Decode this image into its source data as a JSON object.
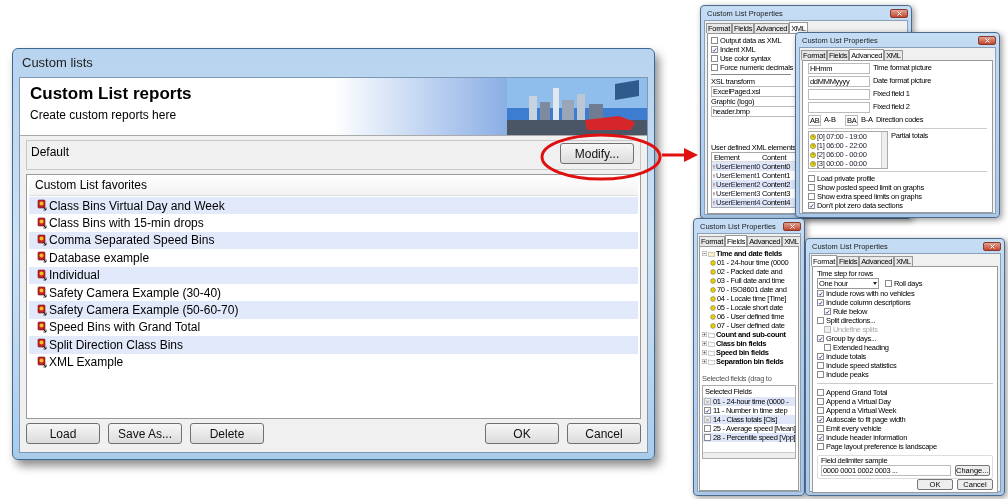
{
  "main_window": {
    "title": "Custom lists",
    "header": {
      "title": "Custom List reports",
      "subtitle": "Create custom reports here"
    },
    "profile": {
      "name": "Default",
      "button": "Modify..."
    },
    "list": {
      "header": "Custom List favorites",
      "items": [
        {
          "label": "Class Bins Virtual Day and Week"
        },
        {
          "label": "Class Bins with 15-min drops"
        },
        {
          "label": "Comma Separated Speed Bins"
        },
        {
          "label": "Database example"
        },
        {
          "label": "Individual"
        },
        {
          "label": "Safety Camera Example (30-40)"
        },
        {
          "label": "Safety Camera Example (50-60-70)"
        },
        {
          "label": "Speed Bins with Grand Total"
        },
        {
          "label": "Split Direction Class Bins"
        },
        {
          "label": "XML Example"
        }
      ]
    },
    "buttons_left": [
      "Load",
      "Save As...",
      "Delete"
    ],
    "buttons_right": [
      "OK",
      "Cancel"
    ]
  },
  "xml_dialog": {
    "title": "Custom List Properties",
    "tabs": [
      {
        "label": "Format",
        "selected": false
      },
      {
        "label": "Fields",
        "selected": false
      },
      {
        "label": "Advanced",
        "selected": false
      },
      {
        "label": "XML",
        "selected": true
      }
    ],
    "options": [
      {
        "label": "Output data as XML",
        "checked": false
      },
      {
        "label": "Indent XML",
        "checked": true
      },
      {
        "label": "Use color syntax",
        "checked": false
      },
      {
        "label": "Force numeric decimals",
        "checked": false
      }
    ],
    "xsl_label": "XSL transform",
    "xsl_value": "ExcelPaged.xsl",
    "graphic_label": "Graphic (logo)",
    "graphic_value": "header.bmp",
    "elements_label": "User defined XML elements",
    "columns": [
      "Element",
      "Content"
    ],
    "rows": [
      [
        "UserElement0",
        "Content0"
      ],
      [
        "UserElement1",
        "Content1"
      ],
      [
        "UserElement2",
        "Content2"
      ],
      [
        "UserElement3",
        "Content3"
      ],
      [
        "UserElement4",
        "Content4"
      ]
    ]
  },
  "advanced_dialog": {
    "title": "Custom List Properties",
    "tabs": [
      {
        "label": "Format",
        "selected": false
      },
      {
        "label": "Fields",
        "selected": false
      },
      {
        "label": "Advanced",
        "selected": true
      },
      {
        "label": "XML",
        "selected": false
      }
    ],
    "fields": [
      {
        "value": "HHmm",
        "label": "Time format picture"
      },
      {
        "value": "ddMMMyyyy",
        "label": "Date format picture"
      },
      {
        "label": "Fixed field 1"
      },
      {
        "label": "Fixed field 2"
      }
    ],
    "direction": {
      "ab_value": "AB",
      "ab_label": "A-B",
      "ba_value": "BA",
      "ba_label": "B-A",
      "label": "Direction codes"
    },
    "partial_totals": {
      "label": "Partial totals",
      "items": [
        "[0] 07:00 - 19:00",
        "[1] 06:00 - 22:00",
        "[2] 06:00 - 00:00",
        "[3] 00:00 - 00:00"
      ]
    },
    "options": [
      {
        "label": "Load private profile",
        "checked": false
      },
      {
        "label": "Show posted speed limit on graphs",
        "checked": false
      },
      {
        "label": "Show extra speed limits on graphs",
        "checked": false
      },
      {
        "label": "Don't plot zero data sections",
        "checked": true
      }
    ]
  },
  "fields_dialog": {
    "title": "Custom List Properties",
    "tabs": [
      {
        "label": "Format",
        "selected": false
      },
      {
        "label": "Fields",
        "selected": true
      },
      {
        "label": "Advanced",
        "selected": false
      },
      {
        "label": "XML",
        "selected": false
      }
    ],
    "tree": [
      {
        "label": "Time and date fields",
        "expanded": true,
        "children": [
          {
            "label": "01 - 24-hour time (0000"
          },
          {
            "label": "02 - Packed date and"
          },
          {
            "label": "03 - Full date and time"
          },
          {
            "label": "70 - ISO8601 date and"
          },
          {
            "label": "04 - Locale time [Time]"
          },
          {
            "label": "05 - Locale short date"
          },
          {
            "label": "06 - User defined time"
          },
          {
            "label": "07 - User defined date"
          }
        ]
      },
      {
        "label": "Count and sub-count",
        "expanded": false
      },
      {
        "label": "Class bin fields",
        "expanded": false
      },
      {
        "label": "Speed bin fields",
        "expanded": false
      },
      {
        "label": "Separation bin fields",
        "expanded": false
      }
    ],
    "selected_label": "Selected fields (drag to",
    "selected_header": "Selected Fields",
    "selected_rows": [
      {
        "label": "01 - 24-hour time (0000 -",
        "checked": true,
        "disabled": true
      },
      {
        "label": "11 - Number in time step",
        "checked": true,
        "disabled": false
      },
      {
        "label": "14 - Class totals [Cls]",
        "checked": true,
        "disabled": true
      },
      {
        "label": "25 - Average speed [Mean]",
        "checked": false,
        "disabled": false
      },
      {
        "label": "28 - Percentile speed [Vpp]",
        "checked": false,
        "disabled": false
      }
    ]
  },
  "format_dialog": {
    "title": "Custom List Properties",
    "tabs": [
      {
        "label": "Format",
        "selected": true
      },
      {
        "label": "Fields",
        "selected": false
      },
      {
        "label": "Advanced",
        "selected": false
      },
      {
        "label": "XML",
        "selected": false
      }
    ],
    "time_step_label": "Time step for rows",
    "time_step_value": "One hour",
    "roll_days": {
      "label": "Roll days",
      "checked": false
    },
    "options": [
      {
        "label": "Include rows with no vehicles",
        "checked": true,
        "disabled": false
      },
      {
        "label": "Include column descriptions",
        "checked": true,
        "disabled": false,
        "children": [
          {
            "label": "Rule below",
            "checked": true,
            "disabled": false
          }
        ]
      },
      {
        "label": "Split directions...",
        "checked": false,
        "disabled": false,
        "children": [
          {
            "label": "Undefine splits",
            "checked": false,
            "disabled": true
          }
        ]
      },
      {
        "label": "Group by days...",
        "checked": true,
        "disabled": false,
        "children": [
          {
            "label": "Extended heading",
            "checked": false,
            "disabled": false
          }
        ]
      },
      {
        "label": "Include totals",
        "checked": true,
        "disabled": false
      },
      {
        "label": "Include speed statistics",
        "checked": false,
        "disabled": false
      },
      {
        "label": "Include peaks",
        "checked": false,
        "disabled": false
      }
    ],
    "options_2": [
      {
        "label": "Append Grand Total",
        "checked": false,
        "disabled": false
      },
      {
        "label": "Append a Virtual Day",
        "checked": false,
        "disabled": false
      },
      {
        "label": "Append a Virtual Week",
        "checked": false,
        "disabled": false
      },
      {
        "label": "Autoscale to fit page width",
        "checked": true,
        "disabled": false
      },
      {
        "label": "Emit every vehicle",
        "checked": false,
        "disabled": false
      },
      {
        "label": "Include header information",
        "checked": true,
        "disabled": false
      },
      {
        "label": "Page layout preference is landscape",
        "checked": false,
        "disabled": false
      }
    ],
    "delimiter_label": "Field delimiter sample",
    "delimiter_value": "0000 0001 0002 0003 ...",
    "change_button": "Change...",
    "buttons": [
      "OK",
      "Cancel"
    ]
  }
}
